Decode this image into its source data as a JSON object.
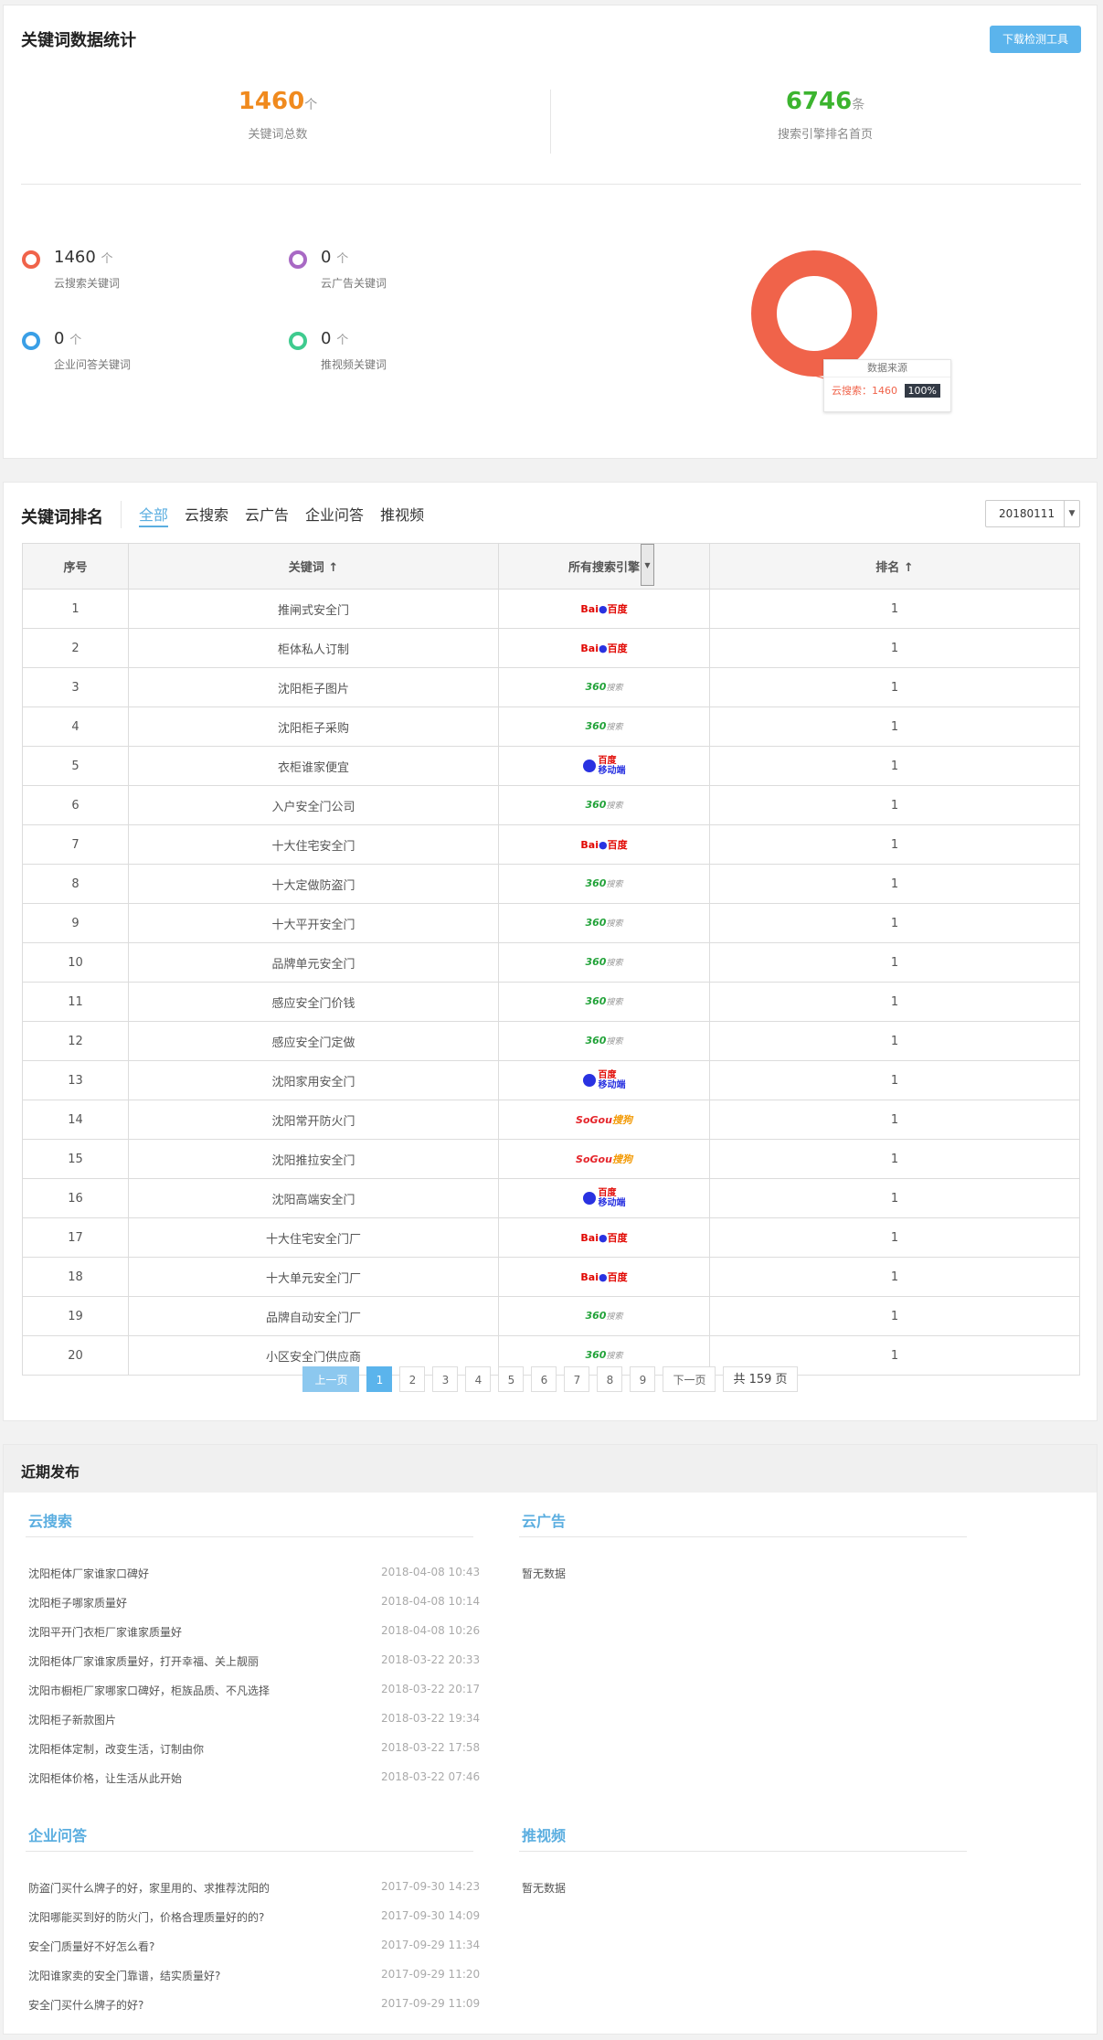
{
  "stats": {
    "title": "关键词数据统计",
    "download_btn": "下载检测工具",
    "total_num": "1460",
    "total_unit": "个",
    "total_label": "关键词总数",
    "first_num": "6746",
    "first_unit": "条",
    "first_label": "搜索引擎排名首页",
    "legend": [
      {
        "value": "1460",
        "unit": "个",
        "label": "云搜索关键词",
        "color": "#f0634a"
      },
      {
        "value": "0",
        "unit": "个",
        "label": "云广告关键词",
        "color": "#a869c4"
      },
      {
        "value": "0",
        "unit": "个",
        "label": "企业问答关键词",
        "color": "#3a9fe6"
      },
      {
        "value": "0",
        "unit": "个",
        "label": "推视频关键词",
        "color": "#3fcb8f"
      }
    ],
    "tooltip_title": "数据来源",
    "tooltip_label": "云搜索：1460",
    "tooltip_badge": "100%"
  },
  "chart_data": {
    "type": "pie",
    "categories": [
      "云搜索"
    ],
    "values": [
      1460
    ]
  },
  "ranking": {
    "title": "关键词排名",
    "tabs": [
      "全部",
      "云搜索",
      "云广告",
      "企业问答",
      "推视频"
    ],
    "date_select": "20180111",
    "columns": [
      "序号",
      "关键词",
      "所有搜索引擎",
      "排名"
    ],
    "sort_arrow": "↑",
    "rows": [
      {
        "no": "1",
        "kw": "推闸式安全门",
        "engine": "baidu",
        "rank": "1"
      },
      {
        "no": "2",
        "kw": "柜体私人订制",
        "engine": "baidu",
        "rank": "1"
      },
      {
        "no": "3",
        "kw": "沈阳柜子图片",
        "engine": "360",
        "rank": "1"
      },
      {
        "no": "4",
        "kw": "沈阳柜子采购",
        "engine": "360",
        "rank": "1"
      },
      {
        "no": "5",
        "kw": "衣柜谁家便宜",
        "engine": "mobile",
        "rank": "1"
      },
      {
        "no": "6",
        "kw": "入户安全门公司",
        "engine": "360",
        "rank": "1"
      },
      {
        "no": "7",
        "kw": "十大住宅安全门",
        "engine": "baidu",
        "rank": "1"
      },
      {
        "no": "8",
        "kw": "十大定做防盗门",
        "engine": "360",
        "rank": "1"
      },
      {
        "no": "9",
        "kw": "十大平开安全门",
        "engine": "360",
        "rank": "1"
      },
      {
        "no": "10",
        "kw": "品牌单元安全门",
        "engine": "360",
        "rank": "1"
      },
      {
        "no": "11",
        "kw": "感应安全门价钱",
        "engine": "360",
        "rank": "1"
      },
      {
        "no": "12",
        "kw": "感应安全门定做",
        "engine": "360",
        "rank": "1"
      },
      {
        "no": "13",
        "kw": "沈阳家用安全门",
        "engine": "mobile",
        "rank": "1"
      },
      {
        "no": "14",
        "kw": "沈阳常开防火门",
        "engine": "sogou",
        "rank": "1"
      },
      {
        "no": "15",
        "kw": "沈阳推拉安全门",
        "engine": "sogou",
        "rank": "1"
      },
      {
        "no": "16",
        "kw": "沈阳高端安全门",
        "engine": "mobile",
        "rank": "1"
      },
      {
        "no": "17",
        "kw": "十大住宅安全门厂",
        "engine": "baidu",
        "rank": "1"
      },
      {
        "no": "18",
        "kw": "十大单元安全门厂",
        "engine": "baidu",
        "rank": "1"
      },
      {
        "no": "19",
        "kw": "品牌自动安全门厂",
        "engine": "360",
        "rank": "1"
      },
      {
        "no": "20",
        "kw": "小区安全门供应商",
        "engine": "360",
        "rank": "1"
      }
    ],
    "engine_text": {
      "baidu_a": "Bai",
      "baidu_b": "百度",
      "s360_a": "360",
      "s360_b": "搜索",
      "mobile_a": "百度",
      "mobile_b": "移动端",
      "sogou_a": "SoGou",
      "sogou_b": "搜狗"
    },
    "pager": {
      "prev": "上一页",
      "pages": [
        "1",
        "2",
        "3",
        "4",
        "5",
        "6",
        "7",
        "8",
        "9"
      ],
      "next": "下一页",
      "total": "共 159 页"
    }
  },
  "recent": {
    "title": "近期发布",
    "sections": [
      {
        "title": "云搜索",
        "items": [
          {
            "text": "沈阳柜体厂家谁家口碑好",
            "date": "2018-04-08 10:43"
          },
          {
            "text": "沈阳柜子哪家质量好",
            "date": "2018-04-08 10:14"
          },
          {
            "text": "沈阳平开门衣柜厂家谁家质量好",
            "date": "2018-04-08 10:26"
          },
          {
            "text": "沈阳柜体厂家谁家质量好，打开幸福、关上靓丽",
            "date": "2018-03-22 20:33"
          },
          {
            "text": "沈阳市橱柜厂家哪家口碑好，柜族品质、不凡选择",
            "date": "2018-03-22 20:17"
          },
          {
            "text": "沈阳柜子新款图片",
            "date": "2018-03-22 19:34"
          },
          {
            "text": "沈阳柜体定制，改变生活，订制由你",
            "date": "2018-03-22 17:58"
          },
          {
            "text": "沈阳柜体价格，让生活从此开始",
            "date": "2018-03-22 07:46"
          }
        ]
      },
      {
        "title": "云广告",
        "empty": "暂无数据"
      },
      {
        "title": "企业问答",
        "items": [
          {
            "text": "防盗门买什么牌子的好，家里用的、求推荐沈阳的",
            "date": "2017-09-30 14:23"
          },
          {
            "text": "沈阳哪能买到好的防火门，价格合理质量好的的?",
            "date": "2017-09-30 14:09"
          },
          {
            "text": "安全门质量好不好怎么看?",
            "date": "2017-09-29 11:34"
          },
          {
            "text": "沈阳谁家卖的安全门靠谱，结实质量好?",
            "date": "2017-09-29 11:20"
          },
          {
            "text": "安全门买什么牌子的好?",
            "date": "2017-09-29 11:09"
          }
        ]
      },
      {
        "title": "推视频",
        "empty": "暂无数据"
      }
    ]
  }
}
